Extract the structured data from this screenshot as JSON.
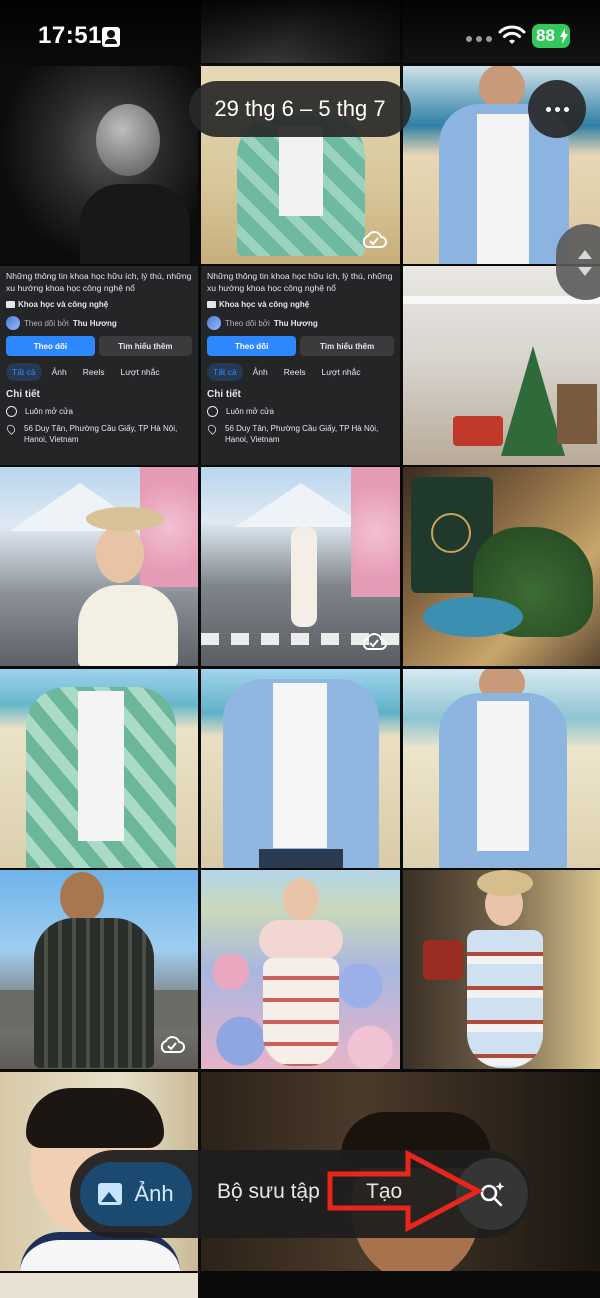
{
  "status_bar": {
    "time": "17:51",
    "battery": "88",
    "icons": [
      "person-badge-icon",
      "signal-dots-icon",
      "wifi-icon",
      "battery-charging-icon"
    ]
  },
  "date_range": "29 thg 6 – 5 thg 7",
  "info_card": {
    "description": "Những thông tin khoa học hữu ích, lý thú, những xu hướng khoa học công nghệ nổ",
    "category": "Khoa học và công nghệ",
    "followed_by_prefix": "Theo dõi bởi",
    "followed_by_name": "Thu Hương",
    "follow_button": "Theo dõi",
    "learn_more_button": "Tìm hiểu thêm",
    "tabs": [
      "Tất cả",
      "Ảnh",
      "Reels",
      "Lượt nhắc"
    ],
    "details_title": "Chi tiết",
    "hours": "Luôn mở cửa",
    "address": "56 Duy Tân, Phường Cầu Giấy, TP Hà Nội, Hanoi, Vietnam"
  },
  "bottom_nav": {
    "photos": "Ảnh",
    "collections": "Bộ sưu tập",
    "create": "Tạo"
  },
  "colors": {
    "fb_blue": "#2d88ff",
    "nav_active": "#1b4a70",
    "annotation_arrow": "#e8261c",
    "battery": "#34c759"
  }
}
